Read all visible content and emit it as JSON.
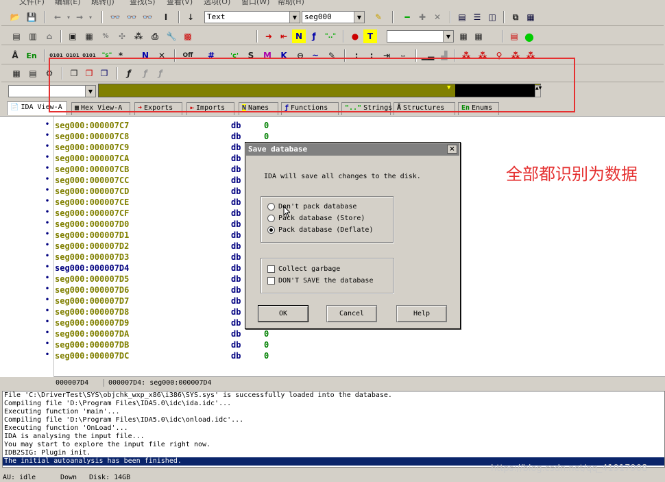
{
  "menu": {
    "items": [
      "文件(F)",
      "编辑(E)",
      "跳转(J)",
      "查找(S)",
      "查看(V)",
      "选项(O)",
      "窗口(W)",
      "帮助(H)"
    ]
  },
  "toolbar": {
    "mode_combo": "Text",
    "segment_combo": "seg000",
    "empty_combo": ""
  },
  "tabs": [
    {
      "icon": "📄",
      "label": "IDA View-A"
    },
    {
      "icon": "▦",
      "label": "Hex View-A"
    },
    {
      "icon": "➜",
      "label": "Exports"
    },
    {
      "icon": "⇤",
      "label": "Imports"
    },
    {
      "icon": "N",
      "label": "Names"
    },
    {
      "icon": "ƒ",
      "label": "Functions"
    },
    {
      "icon": "\"..\"",
      "label": "Strings"
    },
    {
      "icon": "Å",
      "label": "Structures"
    },
    {
      "icon": "En",
      "label": "Enums"
    }
  ],
  "listing": {
    "instruction": "db",
    "value": "0",
    "rows": [
      "seg000:000007C7",
      "seg000:000007C8",
      "seg000:000007C9",
      "seg000:000007CA",
      "seg000:000007CB",
      "seg000:000007CC",
      "seg000:000007CD",
      "seg000:000007CE",
      "seg000:000007CF",
      "seg000:000007D0",
      "seg000:000007D1",
      "seg000:000007D2",
      "seg000:000007D3",
      "seg000:000007D4",
      "seg000:000007D5",
      "seg000:000007D6",
      "seg000:000007D7",
      "seg000:000007D8",
      "seg000:000007D9",
      "seg000:000007DA",
      "seg000:000007DB",
      "seg000:000007DC"
    ],
    "selected_index": 13
  },
  "status": {
    "offset": "000007D4",
    "location": "000007D4: seg000:000007D4"
  },
  "log": [
    "File 'C:\\DriverTest\\SYS\\objchk_wxp_x86\\i386\\SYS.sys' is successfully loaded into the database.",
    "Compiling file 'D:\\Program Files\\IDA5.0\\idc\\ida.idc'...",
    "Executing function 'main'...",
    "Compiling file 'D:\\Program Files\\IDA5.0\\idc\\onload.idc'...",
    "Executing function 'OnLoad'...",
    "IDA is analysing the input file...",
    "You may start to explore the input file right now.",
    "IDB2SIG: Plugin init.",
    "The initial autoanalysis has been finished."
  ],
  "bottom_status": {
    "state": "AU: idle",
    "direction": "Down",
    "disk": "Disk: 14GB"
  },
  "dialog": {
    "title": "Save database",
    "close": "×",
    "message": "IDA will save all changes to the disk.",
    "radios": [
      {
        "label": "Don't pack database",
        "checked": false
      },
      {
        "label": "Pack database (Store)",
        "checked": false
      },
      {
        "label": "Pack database (Deflate)",
        "checked": true
      }
    ],
    "checkboxes": [
      {
        "label": "Collect garbage",
        "checked": false
      },
      {
        "label": "DON'T SAVE the database",
        "checked": false
      }
    ],
    "ok": "OK",
    "cancel": "Cancel",
    "help": "Help"
  },
  "annotation": {
    "text": "全部都识别为数据",
    "color": "#e53030"
  },
  "watermark": "https://blog.csdn.net/qq_41917908"
}
